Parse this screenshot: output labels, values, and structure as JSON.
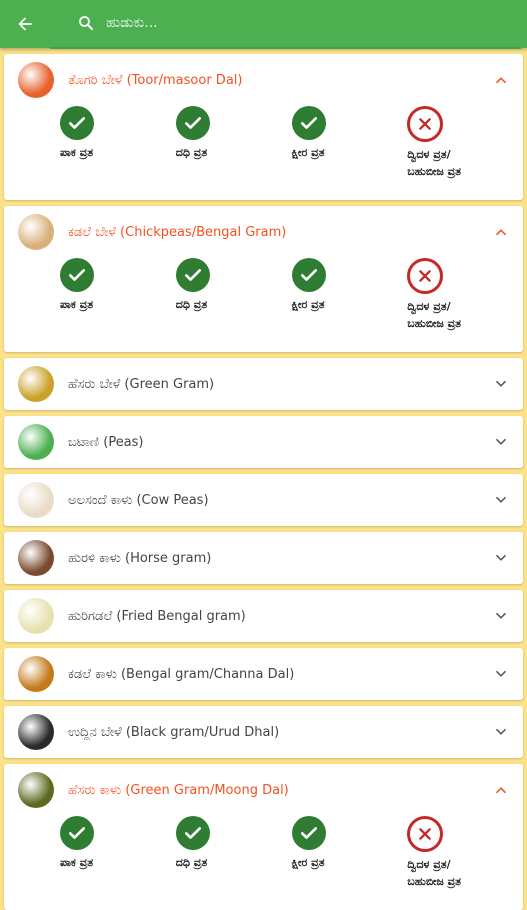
{
  "search": {
    "placeholder": "ಹುಡುಕು..."
  },
  "colors": {
    "appbar": "#4CAF50",
    "background": "#FCE38A",
    "accent_open": "#F4511E",
    "ok": "#2E7D32",
    "no": "#C62828"
  },
  "items": [
    {
      "title": "ತೊಗರಿ ಬೇಳೆ (Toor/masoor Dal)",
      "expanded": true,
      "thumb": "#E8602B",
      "statuses": [
        {
          "label": "ಪಾಕ ವ್ರತ",
          "ok": true
        },
        {
          "label": "ದಧಿ ವ್ರತ",
          "ok": true
        },
        {
          "label": "ಕ್ಷೀರ ವ್ರತ",
          "ok": true
        },
        {
          "label": "ದ್ವಿದಳ ವ್ರತ/ ಬಹುಬೀಜ ವ್ರತ",
          "ok": false
        }
      ]
    },
    {
      "title": "ಕಡಲೆ ಬೇಳೆ (Chickpeas/Bengal Gram)",
      "expanded": true,
      "thumb": "#D9B07A",
      "statuses": [
        {
          "label": "ಪಾಕ ವ್ರತ",
          "ok": true
        },
        {
          "label": "ದಧಿ ವ್ರತ",
          "ok": true
        },
        {
          "label": "ಕ್ಷೀರ ವ್ರತ",
          "ok": true
        },
        {
          "label": "ದ್ವಿದಳ ವ್ರತ/ ಬಹುಬೀಜ ವ್ರತ",
          "ok": false
        }
      ]
    },
    {
      "title": "ಹೆಸರು ಬೇಳೆ (Green Gram)",
      "expanded": false,
      "thumb": "#C9A227"
    },
    {
      "title": "ಬಟಾಣಿ (Peas)",
      "expanded": false,
      "thumb": "#4CAF50"
    },
    {
      "title": "ಅಲಸಂದೆ ಕಾಳು (Cow Peas)",
      "expanded": false,
      "thumb": "#E9DCC8"
    },
    {
      "title": "ಹುರಳಿ ಕಾಳು (Horse gram)",
      "expanded": false,
      "thumb": "#7A4A2E"
    },
    {
      "title": "ಹುರಿಗಡಲೆ (Fried Bengal gram)",
      "expanded": false,
      "thumb": "#E6E2B0"
    },
    {
      "title": "ಕಡಲೆ ಕಾಳು (Bengal gram/Channa Dal)",
      "expanded": false,
      "thumb": "#C47A1A"
    },
    {
      "title": "ಉದ್ದಿನ ಬೇಳೆ (Black gram/Urud Dhal)",
      "expanded": false,
      "thumb": "#2B2B2B"
    },
    {
      "title": "ಹೆಸರು ಕಾಳು (Green Gram/Moong Dal)",
      "expanded": true,
      "thumb": "#5A6B1E",
      "statuses": [
        {
          "label": "ಪಾಕ ವ್ರತ",
          "ok": true
        },
        {
          "label": "ದಧಿ ವ್ರತ",
          "ok": true
        },
        {
          "label": "ಕ್ಷೀರ ವ್ರತ",
          "ok": true
        },
        {
          "label": "ದ್ವಿದಳ ವ್ರತ/ ಬಹುಬೀಜ ವ್ರತ",
          "ok": false
        }
      ]
    }
  ]
}
